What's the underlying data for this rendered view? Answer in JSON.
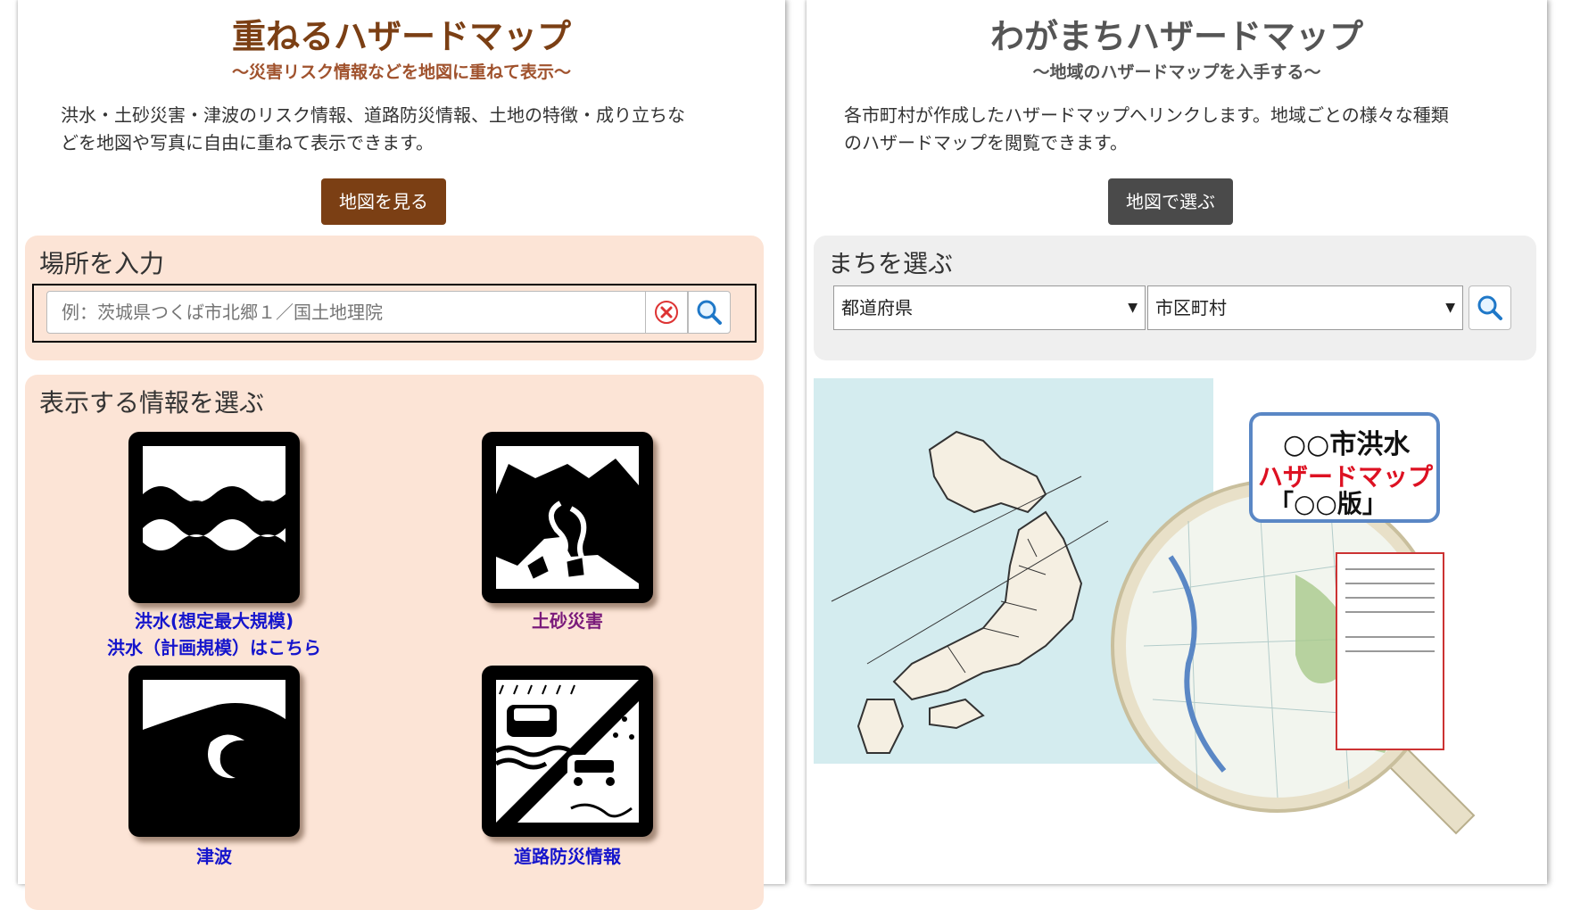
{
  "left": {
    "title": "重ねるハザードマップ",
    "subtitle": "～災害リスク情報などを地図に重ねて表示～",
    "description_line1": "洪水・土砂災害・津波のリスク情報、道路防災情報、土地の特徴・成り立ちな",
    "description_line2": "どを地図や写真に自由に重ねて表示できます。",
    "button_label": "地図を見る",
    "place_box_title": "場所を入力",
    "search_placeholder": "例：茨城県つくば市北郷１／国土地理院",
    "info_box_title": "表示する情報を選ぶ",
    "hazards": {
      "flood_label": "洪水(想定最大規模)",
      "flood_plan_link": "洪水（計画規模）はこちら",
      "landslide_label": "土砂災害",
      "tsunami_label": "津波",
      "road_label": "道路防災情報"
    }
  },
  "right": {
    "title": "わがまちハザードマップ",
    "subtitle": "～地域のハザードマップを入手する～",
    "description_line1": "各市町村が作成したハザードマップへリンクします。地域ごとの様々な種類",
    "description_line2": "のハザードマップを閲覧できます。",
    "button_label": "地図で選ぶ",
    "town_box_title": "まちを選ぶ",
    "prefecture_select": "都道府県",
    "city_select": "市区町村",
    "magnifier_text_line1": "○○市洪水",
    "magnifier_text_line2": "ハザードマップ",
    "magnifier_text_line3": "「○○版」"
  },
  "colors": {
    "left_title": "#7b3f14",
    "left_subtitle": "#a0522d",
    "left_button": "#7b3f14",
    "left_box_bg": "#fce4d6",
    "right_title": "#555555",
    "right_button": "#4a4a4a",
    "right_box_bg": "#efefef",
    "link_blue": "#1515cc",
    "link_purple": "#7a1a7a"
  },
  "icons": [
    "clear-icon",
    "search-icon",
    "flood-icon",
    "landslide-icon",
    "tsunami-icon",
    "road-icon"
  ]
}
